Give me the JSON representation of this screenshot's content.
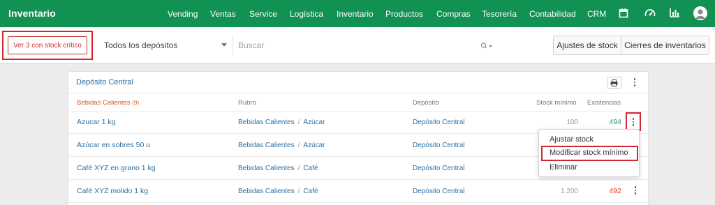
{
  "app": {
    "title": "Inventario"
  },
  "nav": {
    "items": [
      "Vending",
      "Ventas",
      "Service",
      "Logística",
      "Inventario",
      "Productos",
      "Compras",
      "Tesorería",
      "Contabilidad",
      "CRM"
    ],
    "icons": [
      "calendar-icon",
      "speedometer-icon",
      "bar-chart-icon",
      "user-avatar-icon"
    ],
    "bg_color": "#119152"
  },
  "toolbar": {
    "critical_button": "Ver 3 con stock crítico",
    "deposit_select": "Todos los depósitos",
    "search_placeholder": "Buscar",
    "adjust_button": "Ajustes de stock",
    "closures_button": "Cierres de inventarios"
  },
  "card": {
    "title": "Depósito Central",
    "group_name": "Bebidas Calientes",
    "group_count": "(9)",
    "columns": {
      "rubro": "Rubro",
      "deposito": "Depósito",
      "stock_min": "Stock mínimo",
      "existencias": "Existencias"
    },
    "rows": [
      {
        "name": "Azucar 1 kg",
        "rubro_a": "Bebidas Calientes",
        "rubro_sep": "/",
        "rubro_b": "Azúcar",
        "deposito": "Depósito Central",
        "stock_min": "100",
        "existencias": "494",
        "status": "ok"
      },
      {
        "name": "Azúcar en sobres 50 u",
        "rubro_a": "Bebidas Calientes",
        "rubro_sep": "/",
        "rubro_b": "Azúcar",
        "deposito": "Depósito Central",
        "stock_min": "",
        "existencias": "",
        "status": ""
      },
      {
        "name": "Café XYZ en grano 1 kg",
        "rubro_a": "Bebidas Calientes",
        "rubro_sep": "/",
        "rubro_b": "Café",
        "deposito": "Depósito Central",
        "stock_min": "",
        "existencias": "",
        "status": ""
      },
      {
        "name": "Café XYZ molido 1 kg",
        "rubro_a": "Bebidas Calientes",
        "rubro_sep": "/",
        "rubro_b": "Café",
        "deposito": "Depósito Central",
        "stock_min": "1.200",
        "existencias": "492",
        "status": "low"
      }
    ]
  },
  "row_menu": {
    "items": [
      "Ajustar stock",
      "Modificar stock mínimo",
      "Eliminar"
    ]
  },
  "colors": {
    "highlight": "#d0282e",
    "link": "#2a6fa5",
    "ok": "#1a9a8a",
    "low": "#d33a1f"
  }
}
